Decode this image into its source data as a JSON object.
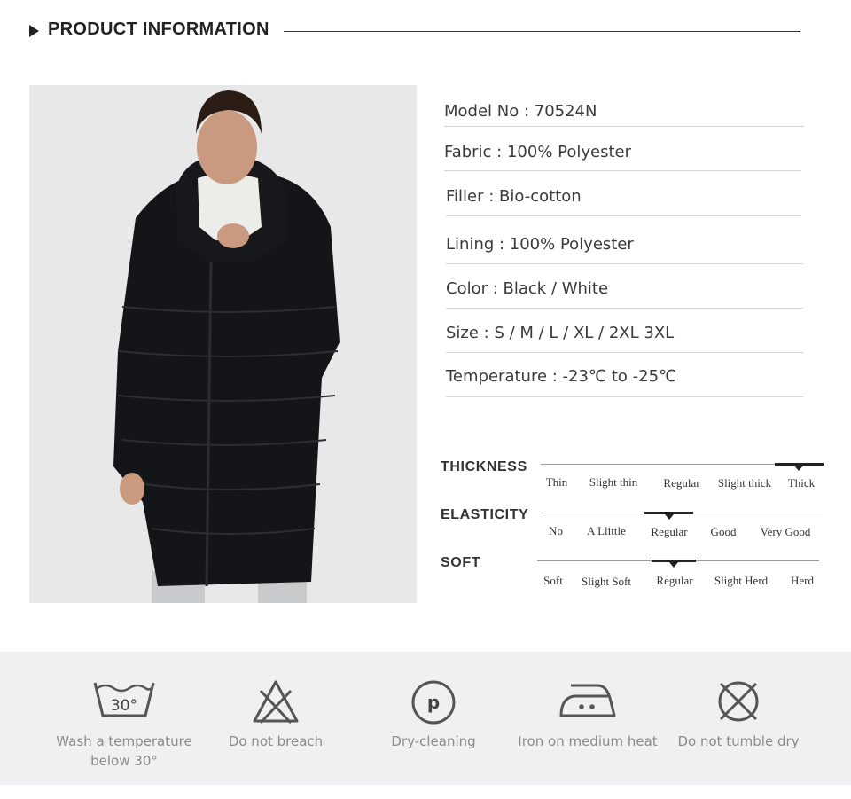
{
  "header": {
    "title": "PRODUCT INFORMATION"
  },
  "specs": [
    {
      "text": "Model No  : 70524N"
    },
    {
      "text": "Fabric  :  100% Polyester"
    },
    {
      "text": "Filler   :   Bio-cotton"
    },
    {
      "text": "Lining :  100% Polyester"
    },
    {
      "text": "Color :  Black / White"
    },
    {
      "text": "Size :  S / M / L / XL / 2XL 3XL"
    },
    {
      "text": "Temperature :  -23℃ to  -25℃"
    }
  ],
  "scales": [
    {
      "label": "THICKNESS",
      "options": [
        "Thin",
        "Slight thin",
        "Regular",
        "Slight thick",
        "Thick"
      ],
      "selected": "Thick"
    },
    {
      "label": "ELASTICITY",
      "options": [
        "No",
        "A Llittle",
        "Regular",
        "Good",
        "Very Good"
      ],
      "selected": "Regular"
    },
    {
      "label": "SOFT",
      "options": [
        "Soft",
        "Slight Soft",
        "Regular",
        "Slight Herd",
        "Herd"
      ],
      "selected": "Regular"
    }
  ],
  "care": [
    {
      "icon": "wash-30-icon",
      "badge": "30°",
      "line1": "Wash a temperature",
      "line2": "below 30°"
    },
    {
      "icon": "no-bleach-icon",
      "line1": "Do not breach",
      "line2": ""
    },
    {
      "icon": "dry-clean-icon",
      "badge": "p",
      "line1": "Dry-cleaning",
      "line2": ""
    },
    {
      "icon": "iron-medium-icon",
      "line1": "Iron on medium heat",
      "line2": ""
    },
    {
      "icon": "no-tumble-dry-icon",
      "line1": "Do not tumble dry",
      "line2": ""
    }
  ],
  "colors": {
    "text": "#3a3a3a",
    "care_bg": "#f0f0f2",
    "photo_bg": "#e7e8e7",
    "jacket": "#141518"
  }
}
